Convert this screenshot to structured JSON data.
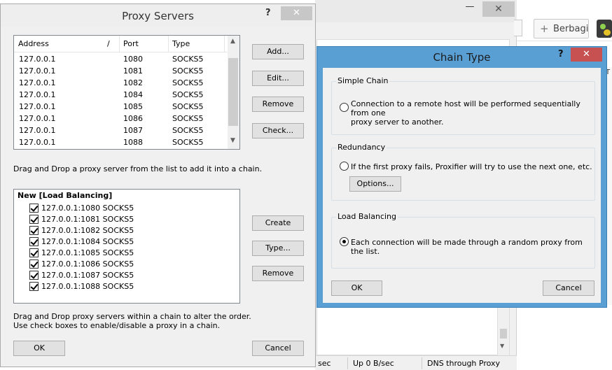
{
  "background_app": {
    "share_button_label": "Berbagi",
    "share_plus": "+",
    "min_glyph": "—",
    "close_glyph": "✕",
    "status": {
      "down_rate": "sec",
      "up_rate": "Up 0 B/sec",
      "dns": "DNS through Proxy"
    },
    "right_cut_text": "T",
    "scroll_down_glyph": "▼"
  },
  "proxy_dialog": {
    "title": "Proxy Servers",
    "help_glyph": "?",
    "close_glyph": "✕",
    "columns": [
      "Address",
      "Port",
      "Type"
    ],
    "sort_indicator": "/",
    "rows": [
      {
        "address": "127.0.0.1",
        "port": "1080",
        "type": "SOCKS5"
      },
      {
        "address": "127.0.0.1",
        "port": "1081",
        "type": "SOCKS5"
      },
      {
        "address": "127.0.0.1",
        "port": "1082",
        "type": "SOCKS5"
      },
      {
        "address": "127.0.0.1",
        "port": "1084",
        "type": "SOCKS5"
      },
      {
        "address": "127.0.0.1",
        "port": "1085",
        "type": "SOCKS5"
      },
      {
        "address": "127.0.0.1",
        "port": "1086",
        "type": "SOCKS5"
      },
      {
        "address": "127.0.0.1",
        "port": "1087",
        "type": "SOCKS5"
      },
      {
        "address": "127.0.0.1",
        "port": "1088",
        "type": "SOCKS5"
      }
    ],
    "scroll_up_glyph": "▲",
    "scroll_down_glyph": "▼",
    "buttons": {
      "add": "Add...",
      "edit": "Edit...",
      "remove": "Remove",
      "check": "Check..."
    },
    "drag_hint": "Drag and Drop a proxy server from the list to add it into a chain.",
    "chain_root": "New [Load Balancing]",
    "chain_items": [
      "127.0.0.1:1080 SOCKS5",
      "127.0.0.1:1081 SOCKS5",
      "127.0.0.1:1082 SOCKS5",
      "127.0.0.1:1084 SOCKS5",
      "127.0.0.1:1085 SOCKS5",
      "127.0.0.1:1086 SOCKS5",
      "127.0.0.1:1087 SOCKS5",
      "127.0.0.1:1088 SOCKS5"
    ],
    "chain_buttons": {
      "create": "Create",
      "type": "Type...",
      "remove": "Remove"
    },
    "chain_hint_1": "Drag and Drop proxy servers within a chain to alter the order.",
    "chain_hint_2": "Use check boxes to enable/disable a proxy in a chain.",
    "ok": "OK",
    "cancel": "Cancel"
  },
  "chain_dialog": {
    "title": "Chain Type",
    "help_glyph": "?",
    "close_glyph": "✕",
    "simple": {
      "label": "Simple Chain",
      "text_1": "Connection to a remote host will be performed sequentially from one",
      "text_2": "proxy server to another.",
      "selected": false
    },
    "redundancy": {
      "label": "Redundancy",
      "text": "If the first proxy fails, Proxifier will try to use the next one, etc.",
      "options_button": "Options...",
      "selected": false
    },
    "load_balancing": {
      "label": "Load Balancing",
      "text": "Each connection will be made through a random proxy from the list.",
      "selected": true
    },
    "ok": "OK",
    "cancel": "Cancel"
  }
}
